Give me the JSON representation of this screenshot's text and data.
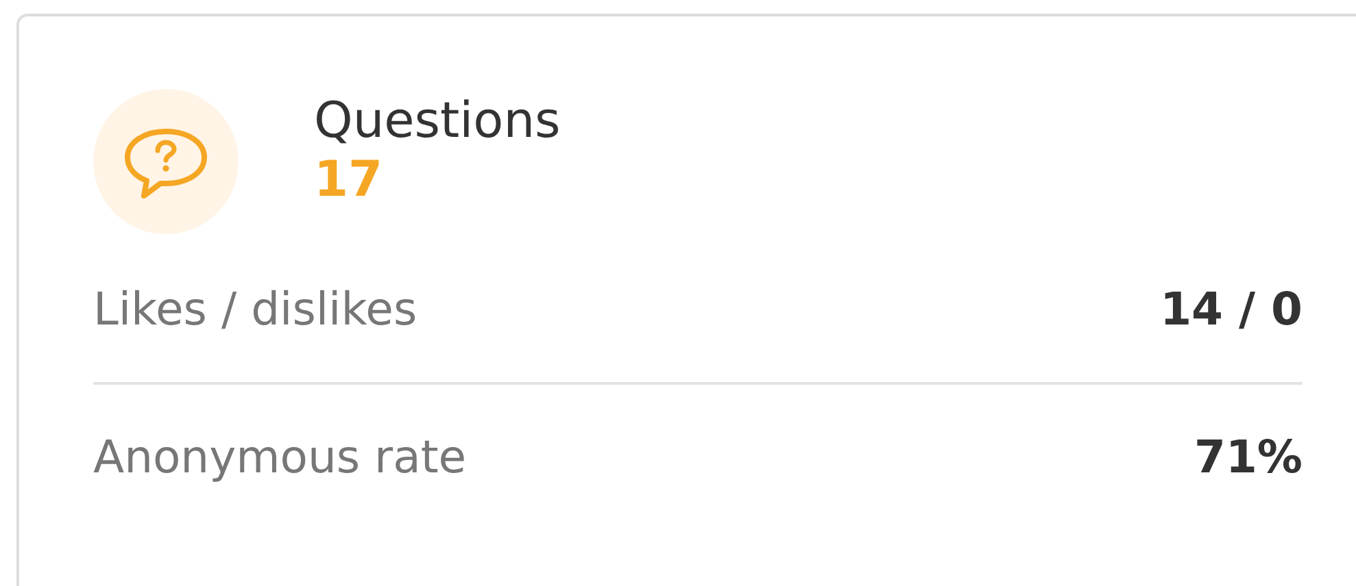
{
  "card": {
    "title": "Questions",
    "value": "17",
    "rows": [
      {
        "label": "Likes / dislikes",
        "value": "14 / 0"
      },
      {
        "label": "Anonymous rate",
        "value": "71%"
      }
    ]
  }
}
